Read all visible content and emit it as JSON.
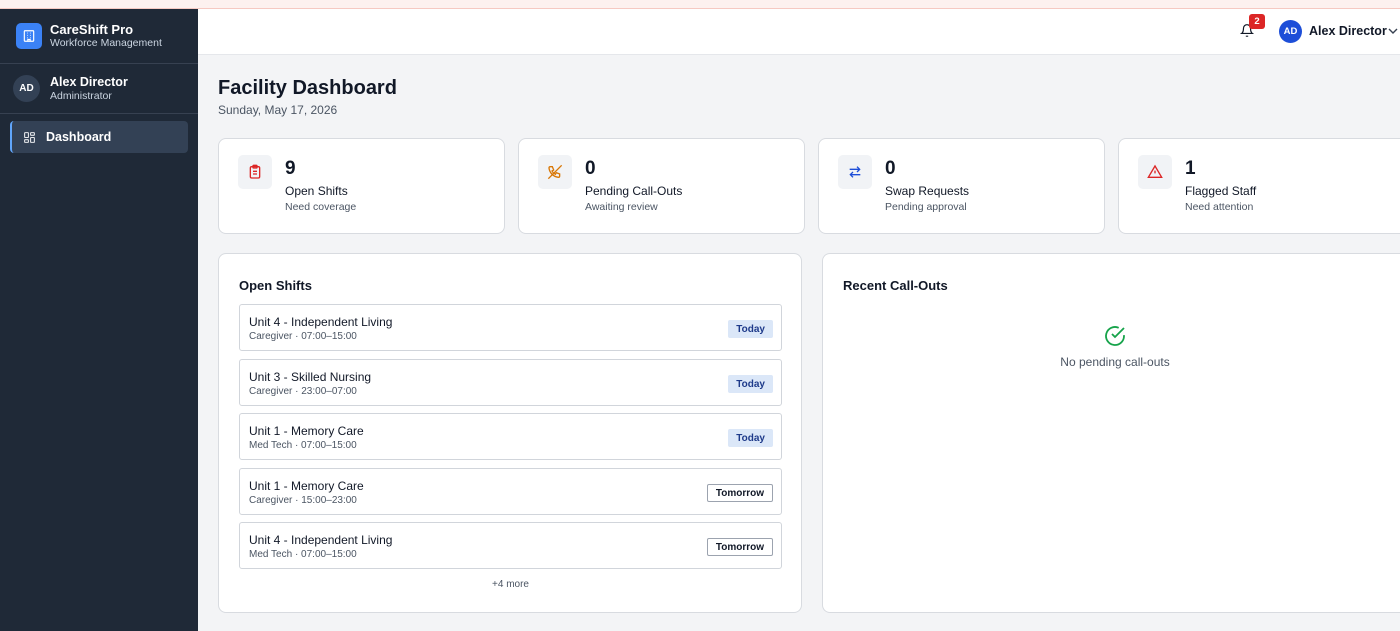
{
  "app": {
    "name": "CareShift Pro",
    "subtitle": "Workforce Management"
  },
  "sidebar": {
    "user": {
      "initials": "AD",
      "name": "Alex Director",
      "role": "Administrator"
    },
    "items": [
      {
        "label": "Dashboard",
        "icon": "grid-icon",
        "active": true
      }
    ]
  },
  "header": {
    "notification_count": "2",
    "user_initials": "AD",
    "user_name": "Alex Director"
  },
  "page": {
    "title": "Facility Dashboard",
    "date": "Sunday, May 17, 2026"
  },
  "stats": [
    {
      "value": "9",
      "label": "Open Shifts",
      "sub": "Need coverage",
      "icon": "clipboard-icon",
      "color": "#dc2626"
    },
    {
      "value": "0",
      "label": "Pending Call-Outs",
      "sub": "Awaiting review",
      "icon": "phone-off-icon",
      "color": "#d97706"
    },
    {
      "value": "0",
      "label": "Swap Requests",
      "sub": "Pending approval",
      "icon": "swap-icon",
      "color": "#1d4ed8"
    },
    {
      "value": "1",
      "label": "Flagged Staff",
      "sub": "Need attention",
      "icon": "warning-icon",
      "color": "#dc2626"
    }
  ],
  "open_shifts": {
    "title": "Open Shifts",
    "rows": [
      {
        "unit": "Unit 4 - Independent Living",
        "meta": "Caregiver · 07:00–15:00",
        "tag": "Today"
      },
      {
        "unit": "Unit 3 - Skilled Nursing",
        "meta": "Caregiver · 23:00–07:00",
        "tag": "Today"
      },
      {
        "unit": "Unit 1 - Memory Care",
        "meta": "Med Tech · 07:00–15:00",
        "tag": "Today"
      },
      {
        "unit": "Unit 1 - Memory Care",
        "meta": "Caregiver · 15:00–23:00",
        "tag": "Tomorrow"
      },
      {
        "unit": "Unit 4 - Independent Living",
        "meta": "Med Tech · 07:00–15:00",
        "tag": "Tomorrow"
      }
    ],
    "more": "+4 more"
  },
  "callouts": {
    "title": "Recent Call-Outs",
    "empty": "No pending call-outs"
  }
}
